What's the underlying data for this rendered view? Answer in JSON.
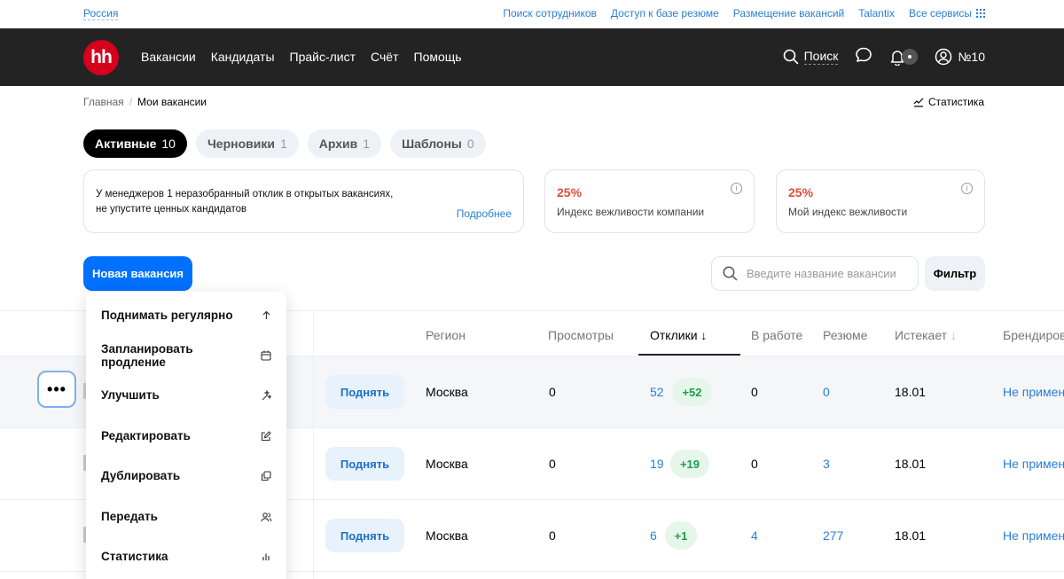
{
  "topbar": {
    "region": "Россия",
    "links": [
      "Поиск сотрудников",
      "Доступ к базе резюме",
      "Размещение вакансий",
      "Talantix",
      "Все сервисы"
    ]
  },
  "header": {
    "logo": "hh",
    "nav": [
      "Вакансии",
      "Кандидаты",
      "Прайс-лист",
      "Счёт",
      "Помощь"
    ],
    "search_label": "Поиск",
    "account_label": "№10"
  },
  "breadcrumb": {
    "home": "Главная",
    "sep": "/",
    "current": "Мои вакансии"
  },
  "stats_link": "Статистика",
  "tabs": [
    {
      "label": "Активные",
      "count": "10"
    },
    {
      "label": "Черновики",
      "count": "1"
    },
    {
      "label": "Архив",
      "count": "1"
    },
    {
      "label": "Шаблоны",
      "count": "0"
    }
  ],
  "notice": {
    "line1": "У менеджеров 1 неразобранный отклик в открытых вакансиях,",
    "line2": "не упустите ценных кандидатов",
    "more": "Подробнее"
  },
  "indexes": [
    {
      "value": "25%",
      "label": "Индекс вежливости компании"
    },
    {
      "value": "25%",
      "label": "Мой индекс вежливости"
    }
  ],
  "actions": {
    "new_vacancy": "Новая вакансия",
    "search_placeholder": "Введите название вакансии",
    "filter": "Фильтр"
  },
  "table": {
    "headers": {
      "region": "Регион",
      "views": "Просмотры",
      "responses": "Отклики",
      "in_work": "В работе",
      "resume": "Резюме",
      "expires": "Истекает",
      "branding": "Брендирование"
    },
    "rows": [
      {
        "raise": "Поднять",
        "region": "Москва",
        "views": "0",
        "responses": "52",
        "delta": "+52",
        "in_work": "0",
        "resume": "0",
        "expires": "18.01",
        "branding": "Не применено"
      },
      {
        "raise": "Поднять",
        "region": "Москва",
        "views": "0",
        "responses": "19",
        "delta": "+19",
        "in_work": "0",
        "resume": "3",
        "expires": "18.01",
        "branding": "Не применено"
      },
      {
        "raise": "Поднять",
        "region": "Москва",
        "views": "0",
        "responses": "6",
        "delta": "+1",
        "in_work": "4",
        "resume": "277",
        "expires": "18.01",
        "branding": "Не применено"
      }
    ]
  },
  "menu": {
    "items": [
      {
        "label": "Поднимать регулярно",
        "icon": "arrow-up-icon"
      },
      {
        "label": "Запланировать продление",
        "icon": "calendar-icon"
      },
      {
        "label": "Улучшить",
        "icon": "sparkle-icon"
      },
      {
        "label": "Редактировать",
        "icon": "edit-icon"
      },
      {
        "label": "Дублировать",
        "icon": "copy-icon"
      },
      {
        "label": "Передать",
        "icon": "users-icon"
      },
      {
        "label": "Статистика",
        "icon": "bar-chart-icon"
      }
    ]
  },
  "row_menu_button": "•••",
  "colors": {
    "brand_red": "#d6001c",
    "accent_blue": "#0070ff",
    "link_blue": "#2a7fd4",
    "index_red": "#e04e39",
    "delta_green": "#1f9d4c"
  }
}
